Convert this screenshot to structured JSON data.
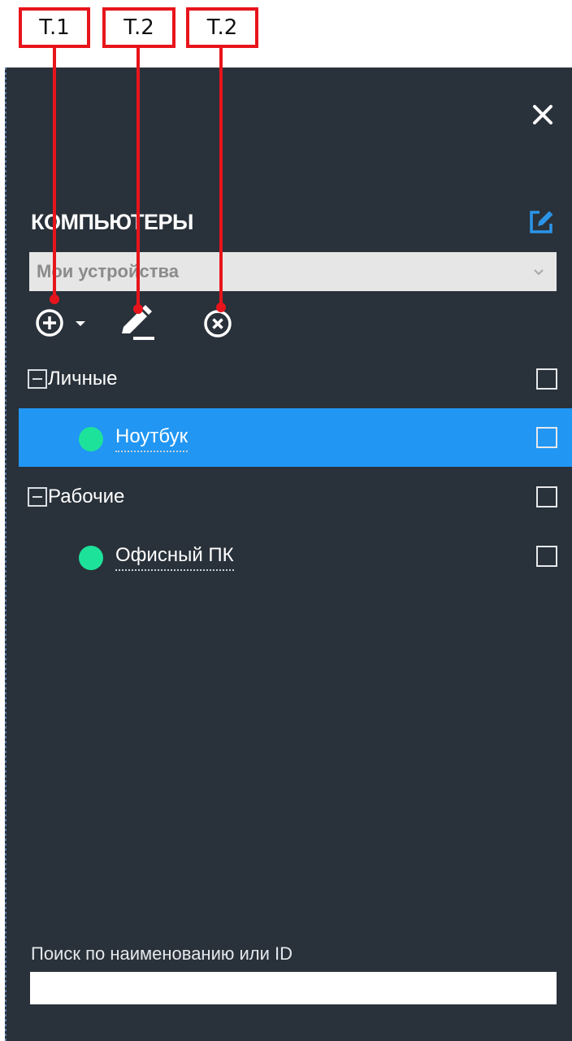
{
  "annotations": [
    {
      "label": "T.1"
    },
    {
      "label": "T.2"
    },
    {
      "label": "T.2"
    }
  ],
  "panel": {
    "title": "КОМПЬЮТЕРЫ",
    "group_select": {
      "value": "Мои устройства"
    },
    "toolbar": {
      "icons": [
        "add-circle-icon",
        "caret-down-icon",
        "pencil-icon",
        "remove-circle-icon"
      ]
    },
    "tree": [
      {
        "group": "Личные",
        "items": [
          {
            "name": "Ноутбук",
            "status_color": "#1de39a",
            "selected": true
          }
        ]
      },
      {
        "group": "Рабочие",
        "items": [
          {
            "name": "Офисный ПК",
            "status_color": "#1de39a",
            "selected": false
          }
        ]
      }
    ],
    "search": {
      "label": "Поиск по наименованию или ID",
      "value": ""
    }
  },
  "colors": {
    "panel_bg": "#29313a",
    "selected_row": "#2196f3",
    "online_status": "#1de39a",
    "edit_icon": "#2b94e8",
    "annotation": "#e8141b"
  }
}
